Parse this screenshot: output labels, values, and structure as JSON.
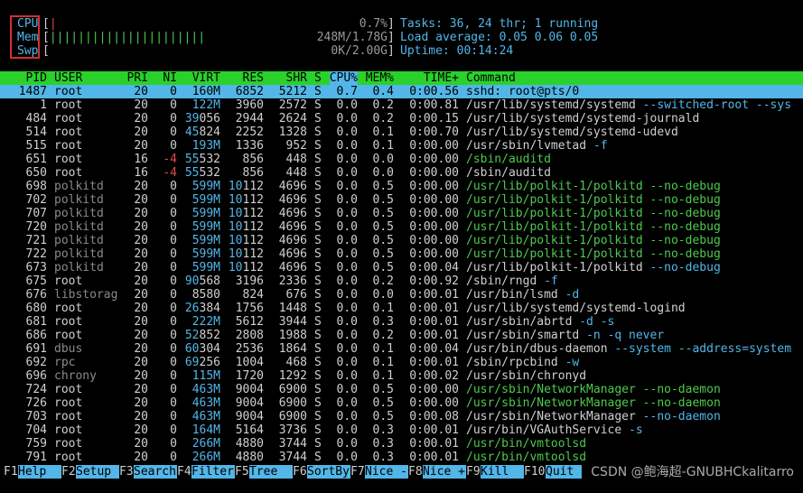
{
  "meters": [
    {
      "label": "CPU",
      "bars": "|",
      "value": "0.7%"
    },
    {
      "label": "Mem",
      "bars": "||||||||||||||||||||||",
      "value": "248M/1.78G"
    },
    {
      "label": "Swp",
      "bars": "",
      "value": "0K/2.00G"
    }
  ],
  "info": {
    "tasks_label": "Tasks:",
    "tasks_value": "36, 24 thr; 1 running",
    "load_label": "Load average:",
    "load_value": "0.05 0.06 0.05",
    "uptime_label": "Uptime:",
    "uptime_value": "00:14:24"
  },
  "columns": [
    "PID",
    "USER",
    "PRI",
    "NI",
    "VIRT",
    "RES",
    "SHR",
    "S",
    "CPU%",
    "MEM%",
    "TIME+",
    "Command"
  ],
  "processes": [
    {
      "pid": "1487",
      "user": "root",
      "pri": "20",
      "ni": "0",
      "virt": "160M",
      "res": "6852",
      "shr": "5212",
      "s": "S",
      "cpu": "0.7",
      "mem": "0.4",
      "time": "0:00.56",
      "cmd": "sshd: root@pts/0",
      "cmd_args": ""
    },
    {
      "pid": "1",
      "user": "root",
      "pri": "20",
      "ni": "0",
      "virt": "122M",
      "res": "3960",
      "shr": "2572",
      "s": "S",
      "cpu": "0.0",
      "mem": "0.2",
      "time": "0:00.81",
      "cmd": "/usr/lib/systemd/systemd",
      "cmd_args": "--switched-root --sys"
    },
    {
      "pid": "484",
      "user": "root",
      "pri": "20",
      "ni": "0",
      "virt": "39056",
      "res": "2944",
      "shr": "2624",
      "s": "S",
      "cpu": "0.0",
      "mem": "0.2",
      "time": "0:00.15",
      "cmd": "/usr/lib/systemd/systemd-journald",
      "cmd_args": ""
    },
    {
      "pid": "514",
      "user": "root",
      "pri": "20",
      "ni": "0",
      "virt": "45824",
      "res": "2252",
      "shr": "1328",
      "s": "S",
      "cpu": "0.0",
      "mem": "0.1",
      "time": "0:00.70",
      "cmd": "/usr/lib/systemd/systemd-udevd",
      "cmd_args": ""
    },
    {
      "pid": "515",
      "user": "root",
      "pri": "20",
      "ni": "0",
      "virt": "193M",
      "res": "1336",
      "shr": "952",
      "s": "S",
      "cpu": "0.0",
      "mem": "0.1",
      "time": "0:00.00",
      "cmd": "/usr/sbin/lvmetad",
      "cmd_args": "-f"
    },
    {
      "pid": "651",
      "user": "root",
      "pri": "16",
      "ni": "-4",
      "virt": "55532",
      "res": "856",
      "shr": "448",
      "s": "S",
      "cpu": "0.0",
      "mem": "0.0",
      "time": "0:00.00",
      "cmd": "/sbin/auditd",
      "cmd_args": "",
      "green": true
    },
    {
      "pid": "650",
      "user": "root",
      "pri": "16",
      "ni": "-4",
      "virt": "55532",
      "res": "856",
      "shr": "448",
      "s": "S",
      "cpu": "0.0",
      "mem": "0.0",
      "time": "0:00.00",
      "cmd": "/sbin/auditd",
      "cmd_args": ""
    },
    {
      "pid": "698",
      "user": "polkitd",
      "pri": "20",
      "ni": "0",
      "virt": "599M",
      "res": "10112",
      "shr": "4696",
      "s": "S",
      "cpu": "0.0",
      "mem": "0.5",
      "time": "0:00.00",
      "cmd": "/usr/lib/polkit-1/polkitd",
      "cmd_args": "--no-debug",
      "green": true
    },
    {
      "pid": "702",
      "user": "polkitd",
      "pri": "20",
      "ni": "0",
      "virt": "599M",
      "res": "10112",
      "shr": "4696",
      "s": "S",
      "cpu": "0.0",
      "mem": "0.5",
      "time": "0:00.00",
      "cmd": "/usr/lib/polkit-1/polkitd",
      "cmd_args": "--no-debug",
      "green": true
    },
    {
      "pid": "707",
      "user": "polkitd",
      "pri": "20",
      "ni": "0",
      "virt": "599M",
      "res": "10112",
      "shr": "4696",
      "s": "S",
      "cpu": "0.0",
      "mem": "0.5",
      "time": "0:00.00",
      "cmd": "/usr/lib/polkit-1/polkitd",
      "cmd_args": "--no-debug",
      "green": true
    },
    {
      "pid": "720",
      "user": "polkitd",
      "pri": "20",
      "ni": "0",
      "virt": "599M",
      "res": "10112",
      "shr": "4696",
      "s": "S",
      "cpu": "0.0",
      "mem": "0.5",
      "time": "0:00.00",
      "cmd": "/usr/lib/polkit-1/polkitd",
      "cmd_args": "--no-debug",
      "green": true
    },
    {
      "pid": "721",
      "user": "polkitd",
      "pri": "20",
      "ni": "0",
      "virt": "599M",
      "res": "10112",
      "shr": "4696",
      "s": "S",
      "cpu": "0.0",
      "mem": "0.5",
      "time": "0:00.00",
      "cmd": "/usr/lib/polkit-1/polkitd",
      "cmd_args": "--no-debug",
      "green": true
    },
    {
      "pid": "722",
      "user": "polkitd",
      "pri": "20",
      "ni": "0",
      "virt": "599M",
      "res": "10112",
      "shr": "4696",
      "s": "S",
      "cpu": "0.0",
      "mem": "0.5",
      "time": "0:00.00",
      "cmd": "/usr/lib/polkit-1/polkitd",
      "cmd_args": "--no-debug",
      "green": true
    },
    {
      "pid": "673",
      "user": "polkitd",
      "pri": "20",
      "ni": "0",
      "virt": "599M",
      "res": "10112",
      "shr": "4696",
      "s": "S",
      "cpu": "0.0",
      "mem": "0.5",
      "time": "0:00.04",
      "cmd": "/usr/lib/polkit-1/polkitd",
      "cmd_args": "--no-debug"
    },
    {
      "pid": "675",
      "user": "root",
      "pri": "20",
      "ni": "0",
      "virt": "90568",
      "res": "3196",
      "shr": "2336",
      "s": "S",
      "cpu": "0.0",
      "mem": "0.2",
      "time": "0:00.92",
      "cmd": "/sbin/rngd",
      "cmd_args": "-f"
    },
    {
      "pid": "676",
      "user": "libstorag",
      "pri": "20",
      "ni": "0",
      "virt": "8580",
      "res": "824",
      "shr": "676",
      "s": "S",
      "cpu": "0.0",
      "mem": "0.0",
      "time": "0:00.01",
      "cmd": "/usr/bin/lsmd",
      "cmd_args": "-d"
    },
    {
      "pid": "680",
      "user": "root",
      "pri": "20",
      "ni": "0",
      "virt": "26384",
      "res": "1756",
      "shr": "1448",
      "s": "S",
      "cpu": "0.0",
      "mem": "0.1",
      "time": "0:00.01",
      "cmd": "/usr/lib/systemd/systemd-logind",
      "cmd_args": ""
    },
    {
      "pid": "681",
      "user": "root",
      "pri": "20",
      "ni": "0",
      "virt": "222M",
      "res": "5612",
      "shr": "3944",
      "s": "S",
      "cpu": "0.0",
      "mem": "0.3",
      "time": "0:00.01",
      "cmd": "/usr/sbin/abrtd",
      "cmd_args": "-d -s"
    },
    {
      "pid": "686",
      "user": "root",
      "pri": "20",
      "ni": "0",
      "virt": "52852",
      "res": "2808",
      "shr": "1988",
      "s": "S",
      "cpu": "0.0",
      "mem": "0.2",
      "time": "0:00.01",
      "cmd": "/usr/sbin/smartd",
      "cmd_args": "-n -q never"
    },
    {
      "pid": "691",
      "user": "dbus",
      "pri": "20",
      "ni": "0",
      "virt": "60304",
      "res": "2536",
      "shr": "1864",
      "s": "S",
      "cpu": "0.0",
      "mem": "0.1",
      "time": "0:00.04",
      "cmd": "/usr/bin/dbus-daemon",
      "cmd_args": "--system --address=system"
    },
    {
      "pid": "692",
      "user": "rpc",
      "pri": "20",
      "ni": "0",
      "virt": "69256",
      "res": "1004",
      "shr": "468",
      "s": "S",
      "cpu": "0.0",
      "mem": "0.1",
      "time": "0:00.01",
      "cmd": "/sbin/rpcbind",
      "cmd_args": "-w"
    },
    {
      "pid": "696",
      "user": "chrony",
      "pri": "20",
      "ni": "0",
      "virt": "115M",
      "res": "1720",
      "shr": "1292",
      "s": "S",
      "cpu": "0.0",
      "mem": "0.1",
      "time": "0:00.02",
      "cmd": "/usr/sbin/chronyd",
      "cmd_args": ""
    },
    {
      "pid": "724",
      "user": "root",
      "pri": "20",
      "ni": "0",
      "virt": "463M",
      "res": "9004",
      "shr": "6900",
      "s": "S",
      "cpu": "0.0",
      "mem": "0.5",
      "time": "0:00.00",
      "cmd": "/usr/sbin/NetworkManager",
      "cmd_args": "--no-daemon",
      "green": true
    },
    {
      "pid": "726",
      "user": "root",
      "pri": "20",
      "ni": "0",
      "virt": "463M",
      "res": "9004",
      "shr": "6900",
      "s": "S",
      "cpu": "0.0",
      "mem": "0.5",
      "time": "0:00.00",
      "cmd": "/usr/sbin/NetworkManager",
      "cmd_args": "--no-daemon",
      "green": true
    },
    {
      "pid": "703",
      "user": "root",
      "pri": "20",
      "ni": "0",
      "virt": "463M",
      "res": "9004",
      "shr": "6900",
      "s": "S",
      "cpu": "0.0",
      "mem": "0.5",
      "time": "0:00.08",
      "cmd": "/usr/sbin/NetworkManager",
      "cmd_args": "--no-daemon"
    },
    {
      "pid": "704",
      "user": "root",
      "pri": "20",
      "ni": "0",
      "virt": "164M",
      "res": "5164",
      "shr": "3736",
      "s": "S",
      "cpu": "0.0",
      "mem": "0.3",
      "time": "0:00.01",
      "cmd": "/usr/bin/VGAuthService",
      "cmd_args": "-s"
    },
    {
      "pid": "759",
      "user": "root",
      "pri": "20",
      "ni": "0",
      "virt": "266M",
      "res": "4880",
      "shr": "3744",
      "s": "S",
      "cpu": "0.0",
      "mem": "0.3",
      "time": "0:00.01",
      "cmd": "/usr/bin/vmtoolsd",
      "cmd_args": "",
      "green": true
    },
    {
      "pid": "791",
      "user": "root",
      "pri": "20",
      "ni": "0",
      "virt": "266M",
      "res": "4880",
      "shr": "3744",
      "s": "S",
      "cpu": "0.0",
      "mem": "0.3",
      "time": "0:00.01",
      "cmd": "/usr/bin/vmtoolsd",
      "cmd_args": "",
      "green": true
    }
  ],
  "footer": [
    {
      "key": "F1",
      "label": "Help"
    },
    {
      "key": "F2",
      "label": "Setup"
    },
    {
      "key": "F3",
      "label": "Search"
    },
    {
      "key": "F4",
      "label": "Filter"
    },
    {
      "key": "F5",
      "label": "Tree"
    },
    {
      "key": "F6",
      "label": "SortBy"
    },
    {
      "key": "F7",
      "label": "Nice -"
    },
    {
      "key": "F8",
      "label": "Nice +"
    },
    {
      "key": "F9",
      "label": "Kill"
    },
    {
      "key": "F10",
      "label": "Quit"
    }
  ],
  "watermark": "CSDN @鲍海超-GNUBHCkalitarro",
  "colors": {
    "header_bg": "#2ad12a",
    "selected_bg": "#52b6e8",
    "accent": "#52b6e8",
    "thread_green": "#4ec94e",
    "nice_red": "#e24a4a",
    "highlight_box": "#d23030"
  }
}
